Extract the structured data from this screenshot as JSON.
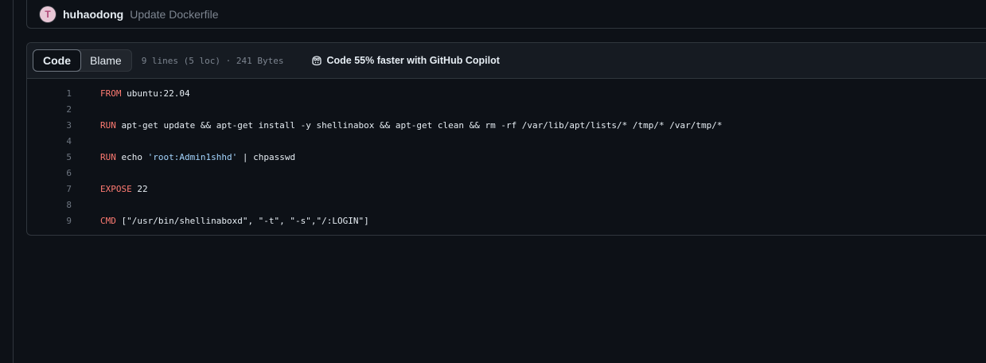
{
  "commit": {
    "avatar_initial": "T",
    "author": "huhaodong",
    "message": "Update Dockerfile"
  },
  "file_header": {
    "tabs": [
      {
        "label": "Code",
        "active": true
      },
      {
        "label": "Blame",
        "active": false
      }
    ],
    "meta": "9 lines (5 loc) · 241 Bytes",
    "copilot": "Code 55% faster with GitHub Copilot",
    "copilot_icon": "copilot-icon"
  },
  "code_lines": [
    {
      "n": "1",
      "kw": "FROM",
      "rest": " ubuntu:22.04"
    },
    {
      "n": "2",
      "kw": "",
      "rest": ""
    },
    {
      "n": "3",
      "kw": "RUN",
      "rest": " apt-get update && apt-get install -y shellinabox && apt-get clean && rm -rf /var/lib/apt/lists/* /tmp/* /var/tmp/*"
    },
    {
      "n": "4",
      "kw": "",
      "rest": ""
    },
    {
      "n": "5",
      "kw": "RUN",
      "rest": " echo ",
      "str": "'root:Admin1shhd'",
      "tail": " | chpasswd"
    },
    {
      "n": "6",
      "kw": "",
      "rest": ""
    },
    {
      "n": "7",
      "kw": "EXPOSE",
      "rest": " 22"
    },
    {
      "n": "8",
      "kw": "",
      "rest": ""
    },
    {
      "n": "9",
      "kw": "CMD",
      "rest": " [\"/usr/bin/shellinaboxd\", \"-t\", \"-s\",\"/:LOGIN\"]"
    }
  ],
  "colors": {
    "background": "#0d1117",
    "keyword": "#ff7b72",
    "string": "#a5d6ff",
    "muted": "#7d8590"
  }
}
